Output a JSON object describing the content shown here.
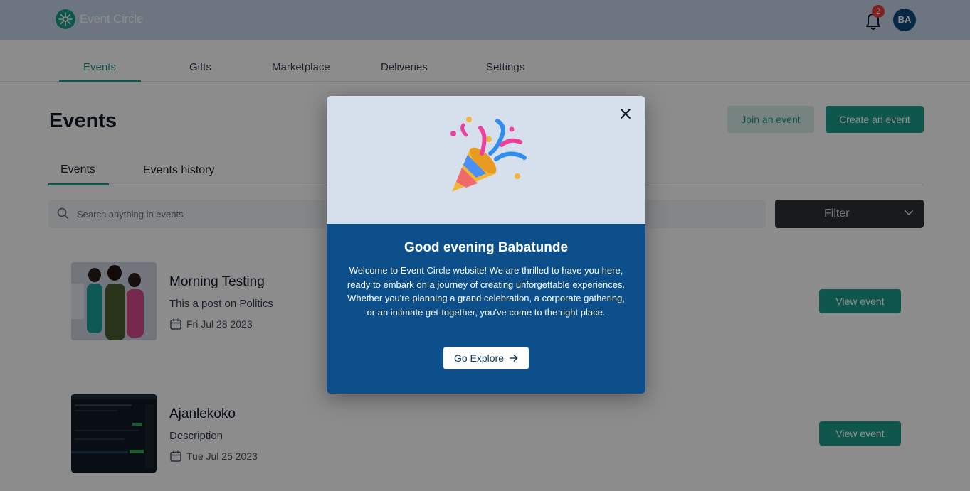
{
  "app": {
    "name": "Event Circle",
    "user_initials": "BA",
    "notification_count": "2"
  },
  "nav": {
    "tabs": [
      "Events",
      "Gifts",
      "Marketplace",
      "Deliveries",
      "Settings"
    ],
    "active": "Events"
  },
  "page": {
    "title": "Events",
    "join_label": "Join an event",
    "create_label": "Create an event"
  },
  "subtabs": [
    "Events",
    "Events history"
  ],
  "search": {
    "placeholder": "Search anything in events"
  },
  "filter": {
    "label": "Filter"
  },
  "events": [
    {
      "title": "Morning Testing",
      "description": "This a post on Politics",
      "date": "Fri Jul 28 2023",
      "action": "View event"
    },
    {
      "title": "Ajanlekoko",
      "description": "Description",
      "date": "Tue Jul 25 2023",
      "action": "View event"
    }
  ],
  "modal": {
    "title": "Good evening Babatunde",
    "body": "Welcome to Event Circle website! We are thrilled to have you here, ready to embark on a journey of creating unforgettable experiences. Whether you're planning a grand celebration, a corporate gathering, or an intimate get-together, you've come to the right place.",
    "cta": "Go Explore"
  },
  "colors": {
    "accent": "#1d9e8a",
    "modal_blue": "#0c4f8a",
    "badge": "#e53e3e"
  },
  "icons": [
    "logo-icon",
    "bell-icon",
    "search-icon",
    "chevron-down-icon",
    "calendar-icon",
    "close-icon",
    "party-popper-icon",
    "arrow-right-icon"
  ]
}
